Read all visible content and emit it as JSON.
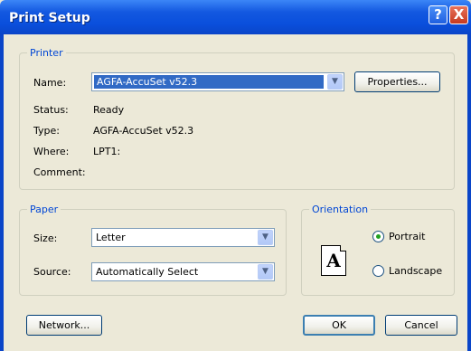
{
  "window": {
    "title": "Print Setup",
    "help_label": "?",
    "close_label": "X"
  },
  "printer": {
    "group_label": "Printer",
    "name_label": "Name:",
    "name_value": "AGFA-AccuSet v52.3",
    "properties_label": "Properties...",
    "status_label": "Status:",
    "status_value": "Ready",
    "type_label": "Type:",
    "type_value": "AGFA-AccuSet v52.3",
    "where_label": "Where:",
    "where_value": "LPT1:",
    "comment_label": "Comment:"
  },
  "paper": {
    "group_label": "Paper",
    "size_label": "Size:",
    "size_value": "Letter",
    "source_label": "Source:",
    "source_value": "Automatically Select"
  },
  "orientation": {
    "group_label": "Orientation",
    "page_glyph": "A",
    "portrait_label": "Portrait",
    "landscape_label": "Landscape",
    "selected": "Portrait"
  },
  "buttons": {
    "network_label": "Network...",
    "ok_label": "OK",
    "cancel_label": "Cancel"
  }
}
